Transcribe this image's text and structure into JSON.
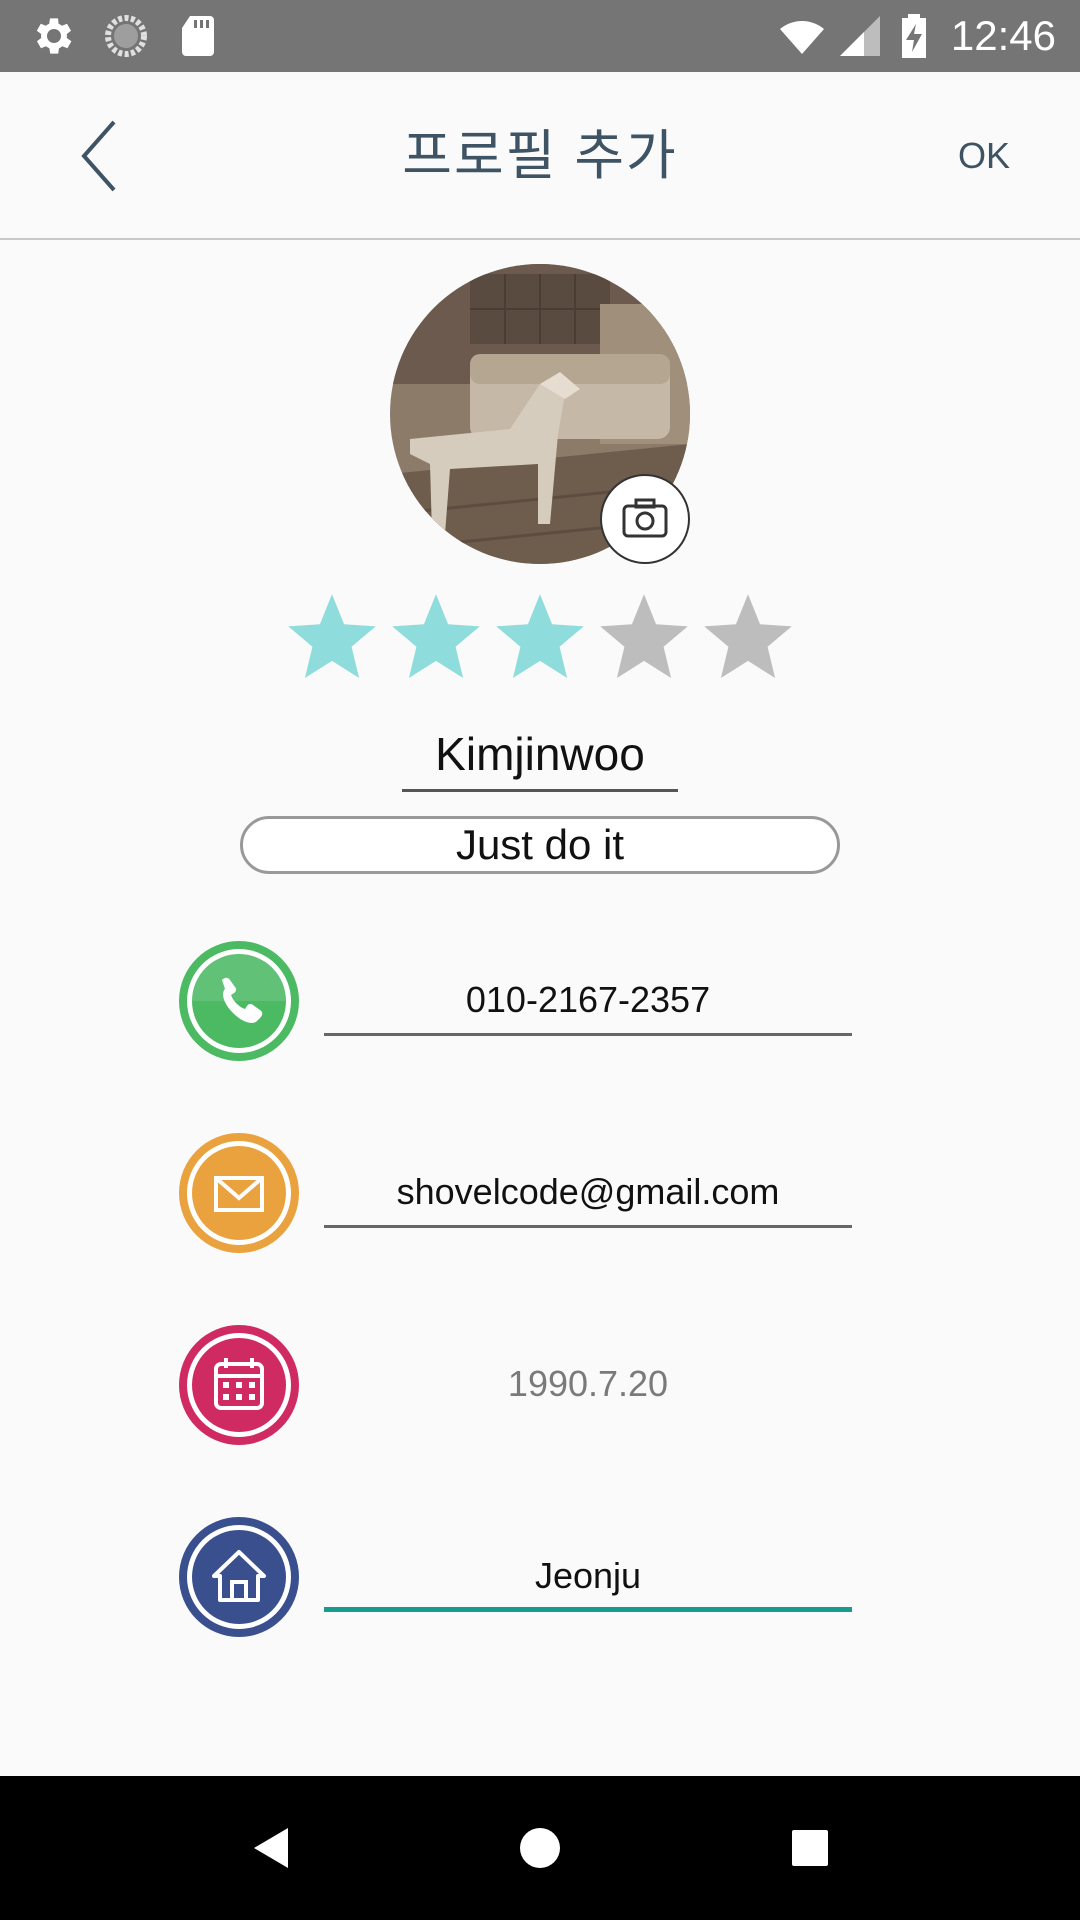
{
  "status_bar": {
    "time": "12:46",
    "icons": [
      "settings-icon",
      "loading-icon",
      "sd-card-icon",
      "wifi-icon",
      "signal-icon",
      "battery-charging-icon"
    ]
  },
  "app_bar": {
    "back_icon": "chevron-left-icon",
    "title": "프로필 추가",
    "ok_label": "OK"
  },
  "profile": {
    "avatar": "profile-photo",
    "camera_icon": "camera-icon",
    "rating": 3,
    "rating_max": 5,
    "name": "Kimjinwoo",
    "status_message": "Just do it"
  },
  "fields": {
    "phone": {
      "icon": "phone-icon",
      "value": "010-2167-2357",
      "color": "#4cb963"
    },
    "email": {
      "icon": "mail-icon",
      "value": "shovelcode@gmail.com",
      "color": "#eaa23f"
    },
    "birthday": {
      "icon": "calendar-icon",
      "value": "1990.7.20",
      "color": "#cf2b62"
    },
    "address": {
      "icon": "home-icon",
      "value": "Jeonju",
      "color": "#3a4f8e"
    }
  },
  "colors": {
    "star_active": "#8fdcdc",
    "star_inactive": "#bdbdbd",
    "focus_underline": "#179c8e"
  },
  "nav_bar": {
    "icons": [
      "back-triangle-icon",
      "home-circle-icon",
      "recents-square-icon"
    ]
  }
}
